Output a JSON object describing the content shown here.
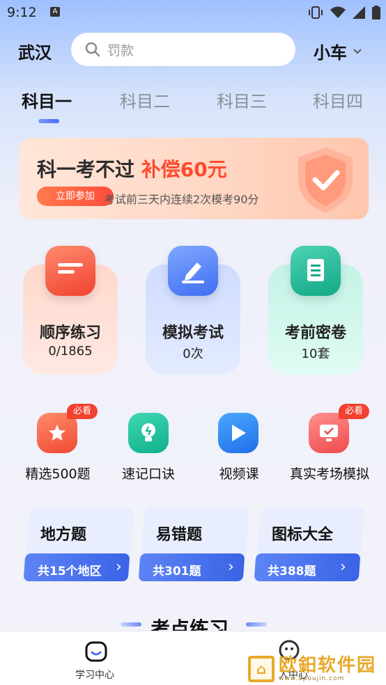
{
  "status": {
    "time": "9:12",
    "notif_glyph": "A"
  },
  "header": {
    "city": "武汉",
    "search_placeholder": "罚款",
    "vehicle": "小车"
  },
  "tabs": [
    {
      "label": "科目一",
      "active": true
    },
    {
      "label": "科目二",
      "active": false
    },
    {
      "label": "科目三",
      "active": false
    },
    {
      "label": "科目四",
      "active": false
    }
  ],
  "banner": {
    "title_prefix": "科一考不过",
    "title_highlight": "补偿60元",
    "button": "立即参加",
    "desc": "考试前三天内连续2次模考90分"
  },
  "main_cards": [
    {
      "title": "顺序练习",
      "sub": "0/1865",
      "icon": "list-icon",
      "color": "#f0432f"
    },
    {
      "title": "模拟考试",
      "sub": "0次",
      "icon": "pen-icon",
      "color": "#3f6ef2"
    },
    {
      "title": "考前密卷",
      "sub": "10套",
      "icon": "scroll-icon",
      "color": "#10a886"
    }
  ],
  "quick": [
    {
      "label": "精选500题",
      "icon": "star-icon",
      "badge": "必看"
    },
    {
      "label": "速记口诀",
      "icon": "bulb-icon",
      "badge": ""
    },
    {
      "label": "视频课",
      "icon": "play-icon",
      "badge": ""
    },
    {
      "label": "真实考场模拟",
      "icon": "monitor-icon",
      "badge": "必看"
    }
  ],
  "topic_cards": [
    {
      "title": "地方题",
      "button": "共15个地区"
    },
    {
      "title": "易错题",
      "button": "共301题"
    },
    {
      "title": "图标大全",
      "button": "共388题"
    }
  ],
  "section": {
    "title": "考点练习"
  },
  "nav": {
    "study": "学习中心",
    "second_partial": "人中心"
  },
  "watermark": {
    "text": "欧鈤软件园",
    "url": "www.apoujin.com"
  }
}
